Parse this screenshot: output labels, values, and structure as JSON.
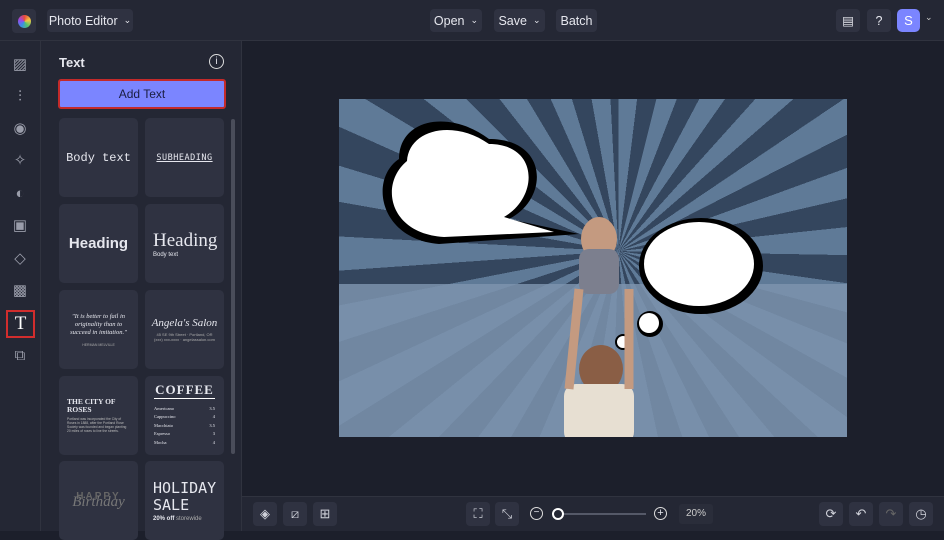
{
  "header": {
    "app_mode": "Photo Editor",
    "open": "Open",
    "save": "Save",
    "batch": "Batch",
    "avatar": "S"
  },
  "panel": {
    "title": "Text",
    "add_text": "Add Text",
    "cards": {
      "body": "Body text",
      "subheading": "SUBHEADING",
      "heading_sans": "Heading",
      "heading_serif": "Heading",
      "heading_serif_sub": "Body text",
      "quote": "\"It is better to fail in originality than to succeed in imitation.\"",
      "quote_author": "HERMAN MELVILLE",
      "salon": "Angela's Salon",
      "salon_addr": "45 SE 9th Street · Portland, OR",
      "salon_contact": "(xxx) xxx-xxxx · angelassalon.com",
      "city": "THE CITY OF ROSES",
      "city_body": "Portland was incorporated the City of Roses in 1888, after the Portland Rose Society was founded and began planting 20 miles of roses to line the streets.",
      "coffee": "COFFEE",
      "menu": [
        [
          "Americano",
          "3.5"
        ],
        [
          "Cappuccino",
          "4"
        ],
        [
          "Macchiato",
          "3.5"
        ],
        [
          "Espresso",
          "3"
        ],
        [
          "Mocha",
          "4"
        ]
      ],
      "birthday_top": "HAPPY",
      "birthday": "Birthday",
      "holiday": "HOLIDAY SALE",
      "holiday_sub": "20% off",
      "holiday_sub2": "storewide"
    }
  },
  "zoom": {
    "level": "20%",
    "slider_fraction": 0.0
  },
  "colors": {
    "accent": "#7b85ff",
    "highlight": "#d12d2d"
  }
}
